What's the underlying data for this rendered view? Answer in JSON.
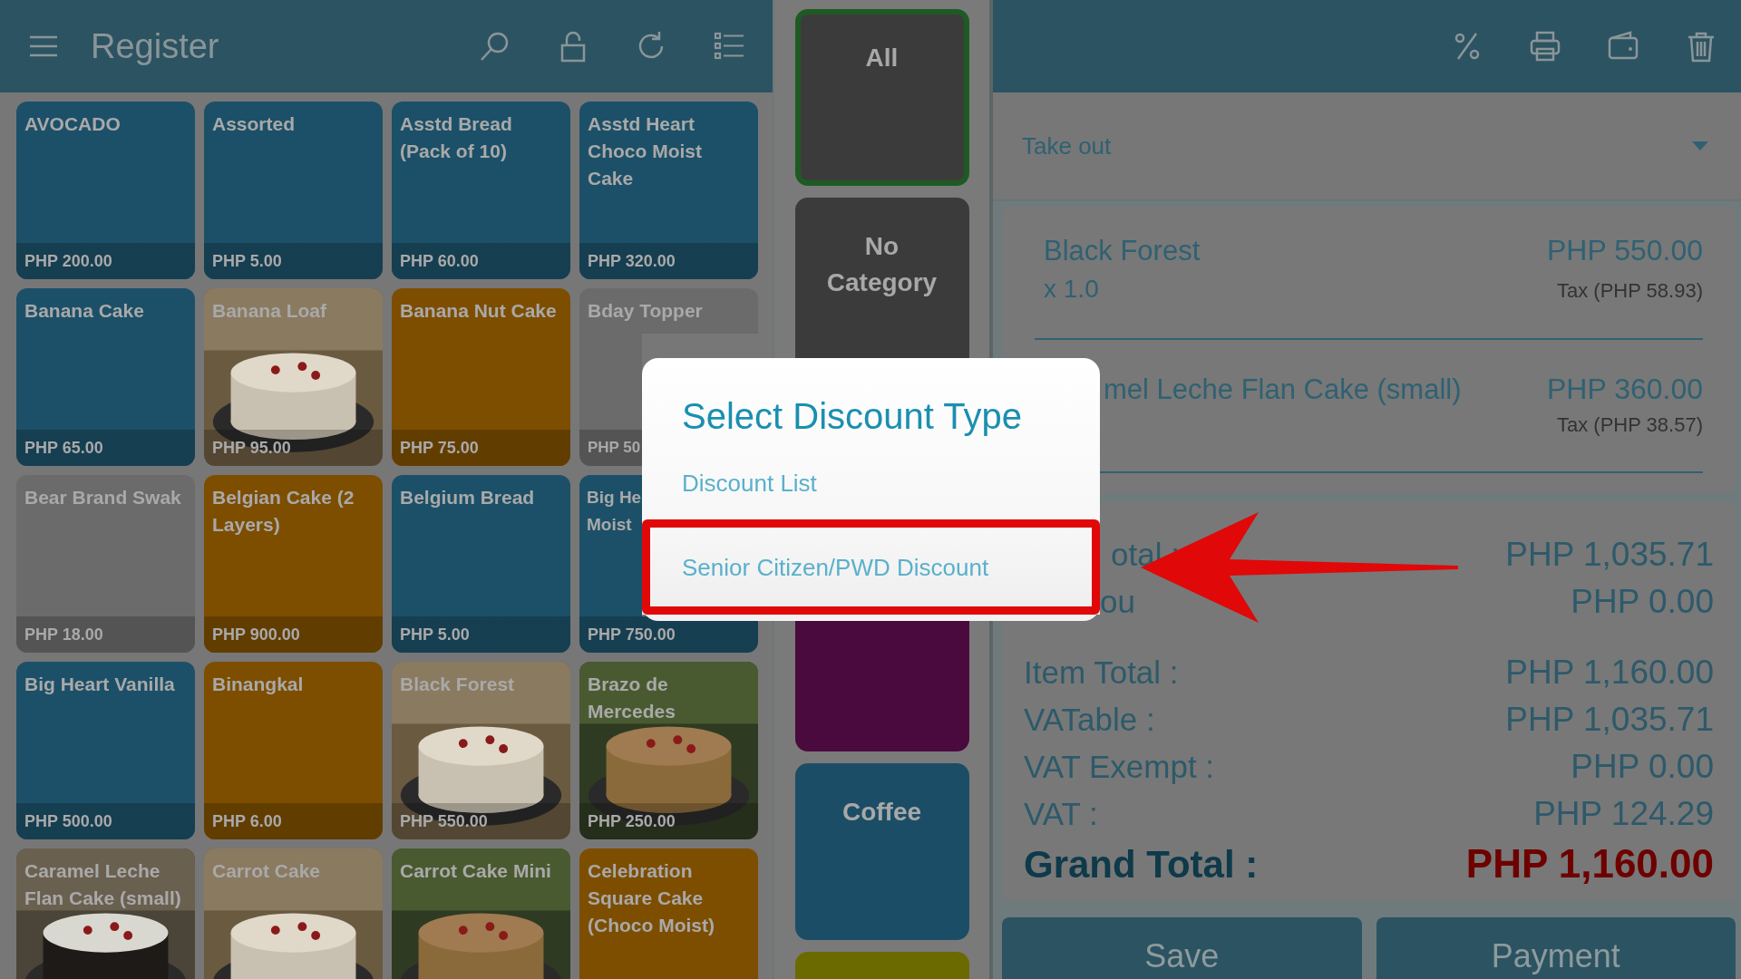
{
  "register": {
    "title": "Register"
  },
  "products": [
    {
      "name": "AVOCADO",
      "price": "PHP 200.00",
      "kind": "color",
      "color": "#1c5068"
    },
    {
      "name": "Assorted",
      "price": "PHP 5.00",
      "kind": "color",
      "color": "#1c5068"
    },
    {
      "name": "Asstd Bread (Pack of 10)",
      "price": "PHP 60.00",
      "kind": "color",
      "color": "#1c5068"
    },
    {
      "name": "Asstd Heart Choco Moist Cake",
      "price": "PHP 320.00",
      "kind": "color",
      "color": "#1c5068"
    },
    {
      "name": "Banana Cake",
      "price": "PHP 65.00",
      "kind": "color",
      "color": "#1c5068"
    },
    {
      "name": "Banana Loaf",
      "price": "PHP 95.00",
      "kind": "picture"
    },
    {
      "name": "Banana Nut Cake",
      "price": "PHP 75.00",
      "kind": "color",
      "color": "#7d4e00"
    },
    {
      "name": "Bday Topper",
      "price": "PHP 50",
      "kind": "color",
      "color": "#6b6b6b"
    },
    {
      "name": "Bear Brand Swak",
      "price": "PHP 18.00",
      "kind": "color",
      "color": "#6b6b6b"
    },
    {
      "name": "Belgian Cake (2 Layers)",
      "price": "PHP 900.00",
      "kind": "color",
      "color": "#7d4e00"
    },
    {
      "name": "Belgium Bread",
      "price": "PHP 5.00",
      "kind": "color",
      "color": "#1c5068"
    },
    {
      "name": "Big He\nMoist",
      "price": "PHP 750.00",
      "kind": "color",
      "color": "#1c5068"
    },
    {
      "name": "Big Heart Vanilla",
      "price": "PHP 500.00",
      "kind": "color",
      "color": "#1c5068"
    },
    {
      "name": "Binangkal",
      "price": "PHP 6.00",
      "kind": "color",
      "color": "#7d4e00"
    },
    {
      "name": "Black Forest",
      "price": "PHP 550.00",
      "kind": "picture"
    },
    {
      "name": "Brazo de Mercedes",
      "price": "PHP 250.00",
      "kind": "picture"
    },
    {
      "name": "Caramel Leche Flan Cake (small)",
      "kind": "picture"
    },
    {
      "name": "Carrot Cake",
      "kind": "picture"
    },
    {
      "name": "Carrot Cake Mini",
      "kind": "picture"
    },
    {
      "name": "Celebration Square Cake (Choco Moist)",
      "kind": "color",
      "color": "#7d4e00"
    }
  ],
  "categories": [
    {
      "label": "All",
      "selected": true,
      "color": "#3b3b3b"
    },
    {
      "label": "No Category",
      "selected": false,
      "color": "#3b3b3b"
    },
    {
      "selected": false,
      "color": "#4a0a3e"
    },
    {
      "label": "Coffee",
      "selected": false,
      "color": "#1b4e66"
    },
    {
      "selected": false,
      "color": "#6b6a00"
    }
  ],
  "order": {
    "type": "Take out",
    "items": [
      {
        "name": "Black Forest",
        "qty": "x 1.0",
        "price": "PHP 550.00",
        "tax": "Tax (PHP 58.93)"
      },
      {
        "name": "mel Leche Flan Cake (small)",
        "price": "PHP 360.00",
        "tax": "Tax (PHP 38.57)"
      }
    ],
    "summary": [
      {
        "label": "otal :",
        "value": "PHP 1,035.71"
      },
      {
        "label": "ou",
        "value": "PHP 0.00"
      },
      {
        "label": "Item Total :",
        "value": "PHP 1,160.00"
      },
      {
        "label": "VATable :",
        "value": "PHP 1,035.71"
      },
      {
        "label": "VAT Exempt :",
        "value": "PHP 0.00"
      },
      {
        "label": "VAT :",
        "value": "PHP 124.29"
      }
    ],
    "grand_total": {
      "label": "Grand Total :",
      "value": "PHP 1,160.00"
    }
  },
  "actions": [
    "Save",
    "Payment"
  ],
  "dialog": {
    "title": "Select Discount Type",
    "options": [
      {
        "label": "Discount List",
        "highlighted": false
      },
      {
        "label": "Senior Citizen/PWD Discount",
        "highlighted": true
      }
    ]
  }
}
